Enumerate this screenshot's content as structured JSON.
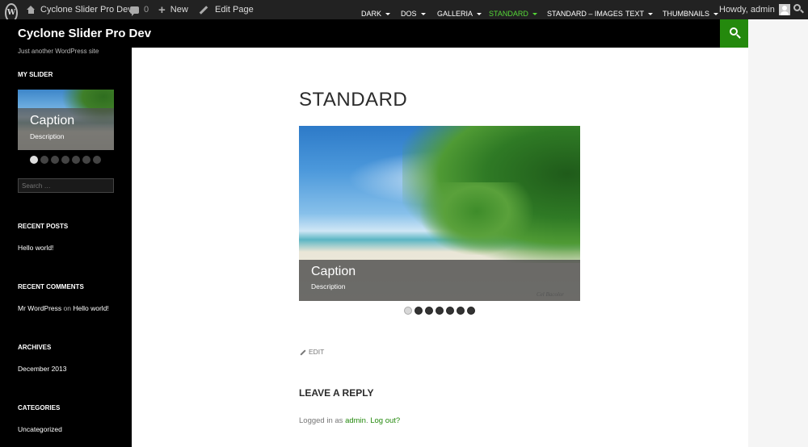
{
  "admin_bar": {
    "site_name": "Cyclone Slider Pro Dev",
    "comments_count": "0",
    "new_label": "New",
    "edit_label": "Edit Page",
    "howdy": "Howdy, admin"
  },
  "header": {
    "site_title": "Cyclone Slider Pro Dev",
    "nav": [
      {
        "label": "Dark",
        "dropdown": true
      },
      {
        "label": "Dos",
        "dropdown": true
      },
      {
        "label": "Galleria",
        "dropdown": true
      },
      {
        "label": "Standard",
        "dropdown": true,
        "active": true
      },
      {
        "label": "Standard – Images",
        "dropdown": false
      },
      {
        "label": "Text",
        "dropdown": true
      },
      {
        "label": "Thumbnails",
        "dropdown": true
      }
    ]
  },
  "sidebar": {
    "tagline": "Just another WordPress site",
    "my_slider_title": "My Slider",
    "slider": {
      "caption": "Caption",
      "description": "Description",
      "slides": 7,
      "active_index": 0
    },
    "search_placeholder": "Search …",
    "recent_posts_title": "Recent Posts",
    "recent_post": "Hello world!",
    "recent_comments_title": "Recent Comments",
    "comment_author": "Mr WordPress",
    "comment_on": "on",
    "comment_post": "Hello world!",
    "archives_title": "Archives",
    "archive_item": "December 2013",
    "categories_title": "Categories",
    "category_item": "Uncategorized"
  },
  "main": {
    "title": "Standard",
    "slider": {
      "caption": "Caption",
      "description": "Description",
      "credit": "Cel Bacolor",
      "slides": 7,
      "active_index": 0
    },
    "edit_label": "Edit",
    "reply_title": "Leave a Reply",
    "logged_in_prefix": "Logged in as",
    "logged_in_user": "admin",
    "logout": "Log out?"
  },
  "colors": {
    "accent": "#24890d",
    "nav_active": "#55d737",
    "admin_bar": "#222222",
    "sidebar": "#000000"
  }
}
